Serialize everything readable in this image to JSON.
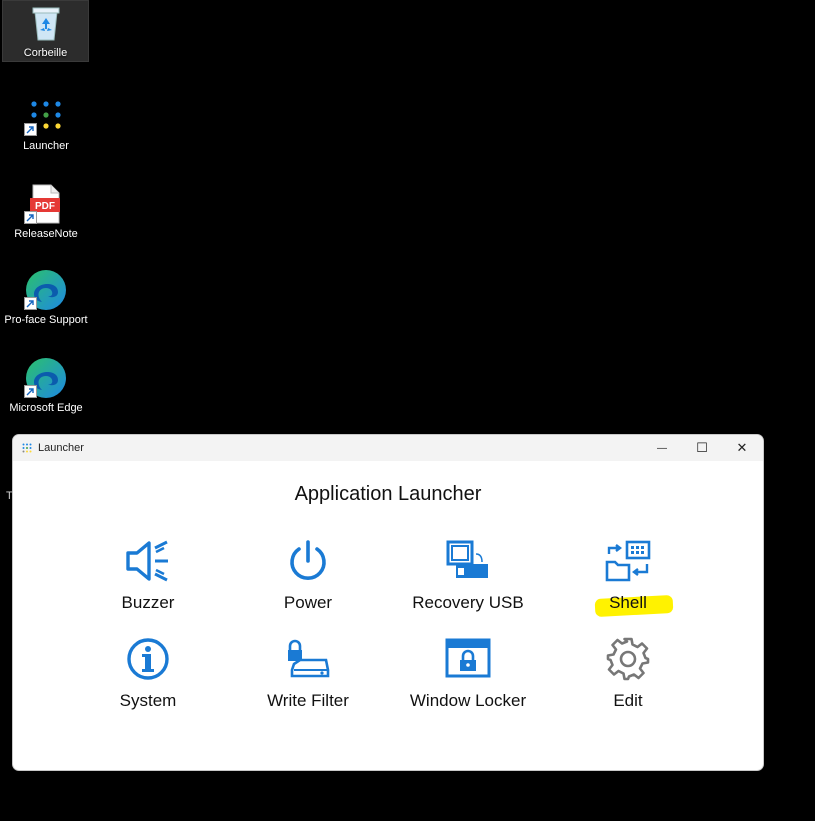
{
  "desktop": {
    "icons": [
      {
        "label": "Corbeille",
        "icon": "recycle-bin-icon"
      },
      {
        "label": "Launcher",
        "icon": "launcher-dots-icon"
      },
      {
        "label": "ReleaseNote",
        "icon": "pdf-file-icon",
        "badge": "PDF"
      },
      {
        "label": "Pro-face Support",
        "icon": "edge-browser-icon"
      },
      {
        "label": "Microsoft Edge",
        "icon": "edge-browser-icon"
      }
    ],
    "stray_text": "T"
  },
  "launcher": {
    "window_title": "Launcher",
    "controls": {
      "minimize": "—",
      "maximize": "☐",
      "close": "✕"
    },
    "heading": "Application Launcher",
    "accent_color": "#1a7ad4",
    "tiles": [
      {
        "label": "Buzzer",
        "icon": "speaker-icon"
      },
      {
        "label": "Power",
        "icon": "power-icon"
      },
      {
        "label": "Recovery USB",
        "icon": "usb-drive-icon"
      },
      {
        "label": "Shell",
        "icon": "shell-swap-icon",
        "highlighted": true
      },
      {
        "label": "System",
        "icon": "info-icon"
      },
      {
        "label": "Write Filter",
        "icon": "lock-drive-icon"
      },
      {
        "label": "Window Locker",
        "icon": "window-lock-icon"
      },
      {
        "label": "Edit",
        "icon": "gear-icon"
      }
    ]
  }
}
